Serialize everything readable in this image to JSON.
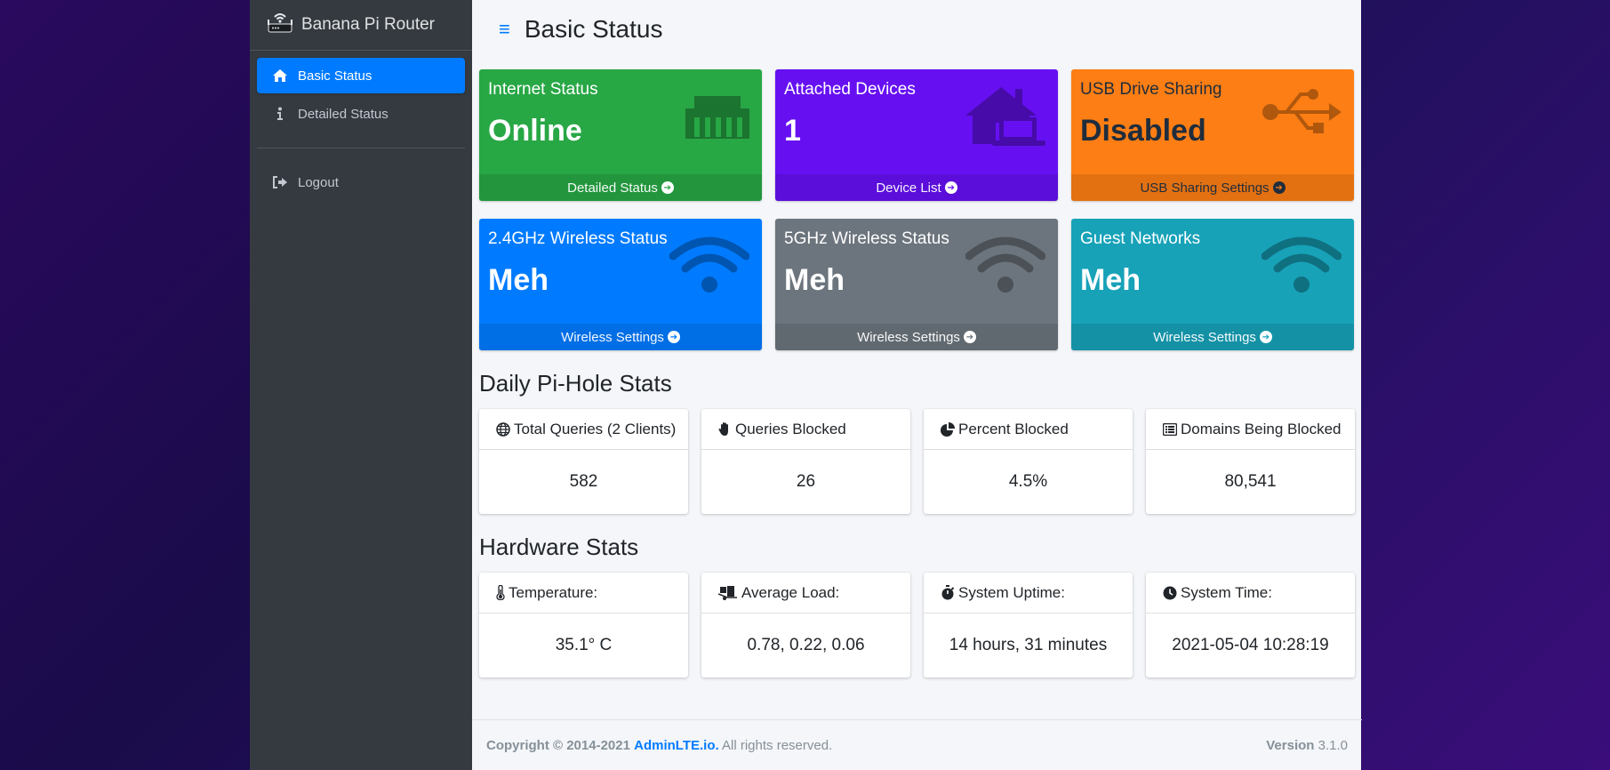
{
  "brand": {
    "name": "Banana Pi Router",
    "icon": "router-icon"
  },
  "sidebar": {
    "items": [
      {
        "label": "Basic Status",
        "icon": "home-icon",
        "active": true
      },
      {
        "label": "Detailed Status",
        "icon": "info-icon",
        "active": false
      },
      {
        "label": "Logout",
        "icon": "sign-out-icon",
        "active": false
      }
    ]
  },
  "header": {
    "title": "Basic Status",
    "menu_icon": "hamburger-icon"
  },
  "boxes": [
    {
      "title": "Internet Status",
      "value": "Online",
      "link": "Detailed Status",
      "color": "#28a745",
      "icon": "ethernet-icon"
    },
    {
      "title": "Attached Devices",
      "value": "1",
      "link": "Device List",
      "color": "#6610f2",
      "icon": "home-laptop-icon"
    },
    {
      "title": "USB Drive Sharing",
      "value": "Disabled",
      "link": "USB Sharing Settings",
      "color": "#fd7e14",
      "icon": "usb-icon"
    },
    {
      "title": "2.4GHz Wireless Status",
      "value": "Meh",
      "link": "Wireless Settings",
      "color": "#007bff",
      "icon": "wifi-icon"
    },
    {
      "title": "5GHz Wireless Status",
      "value": "Meh",
      "link": "Wireless Settings",
      "color": "#6c757d",
      "icon": "wifi-icon"
    },
    {
      "title": "Guest Networks",
      "value": "Meh",
      "link": "Wireless Settings",
      "color": "#17a2b8",
      "icon": "wifi-icon"
    }
  ],
  "pihole": {
    "title": "Daily Pi-Hole Stats",
    "cards": [
      {
        "label": "Total Queries (2 Clients)",
        "value": "582",
        "icon": "globe-icon"
      },
      {
        "label": "Queries Blocked",
        "value": "26",
        "icon": "hand-icon"
      },
      {
        "label": "Percent Blocked",
        "value": "4.5%",
        "icon": "pie-chart-icon"
      },
      {
        "label": "Domains Being Blocked",
        "value": "80,541",
        "icon": "list-icon"
      }
    ]
  },
  "hardware": {
    "title": "Hardware Stats",
    "cards": [
      {
        "label": "Temperature:",
        "value": "35.1° C",
        "icon": "thermometer-icon"
      },
      {
        "label": "Average Load:",
        "value": "0.78, 0.22, 0.06",
        "icon": "truck-loading-icon"
      },
      {
        "label": "System Uptime:",
        "value": "14 hours, 31 minutes",
        "icon": "stopwatch-icon"
      },
      {
        "label": "System Time:",
        "value": "2021-05-04 10:28:19",
        "icon": "clock-icon"
      }
    ]
  },
  "footer": {
    "copyright": "Copyright © 2014-2021",
    "link": "AdminLTE.io.",
    "rights": "All rights reserved.",
    "version_label": "Version",
    "version": "3.1.0"
  }
}
